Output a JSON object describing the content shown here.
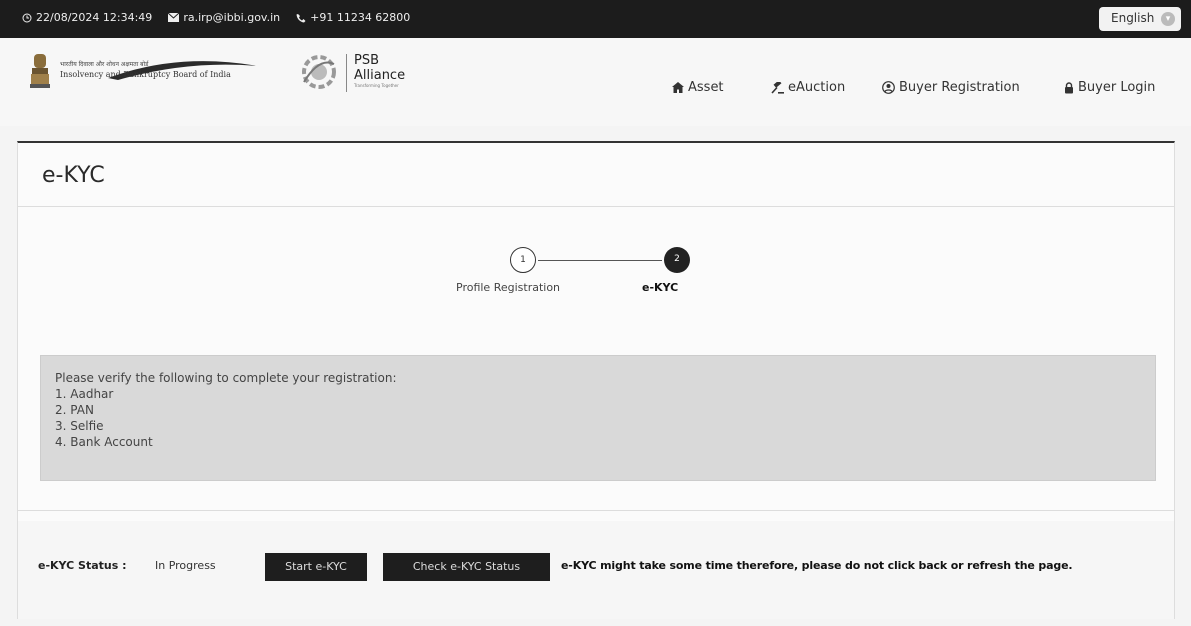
{
  "topbar": {
    "datetime": "22/08/2024 12:34:49",
    "email": "ra.irp@ibbi.gov.in",
    "phone": "+91 11234 62800",
    "language": "English"
  },
  "header": {
    "ibbi_hindi": "भारतीय दिवाला और शोधन अक्षमता बोर्ड",
    "ibbi_name": "Insolvency and Bankruptcy Board of India",
    "psb_line1": "PSB",
    "psb_line2": "Alliance",
    "psb_tagline": "Transforming Together"
  },
  "nav": {
    "asset": "Asset",
    "eauction": "eAuction",
    "buyer_registration": "Buyer Registration",
    "buyer_login": "Buyer Login"
  },
  "page": {
    "title": "e-KYC"
  },
  "stepper": {
    "steps": [
      {
        "number": "1",
        "label": "Profile Registration"
      },
      {
        "number": "2",
        "label": "e-KYC"
      }
    ]
  },
  "instructions": {
    "intro": "Please verify the following to complete your registration:",
    "items": [
      "1. Aadhar",
      "2. PAN",
      "3. Selfie",
      "4. Bank Account"
    ]
  },
  "status": {
    "label": "e-KYC Status :",
    "value": "In Progress",
    "start_button": "Start e-KYC",
    "check_button": "Check e-KYC Status",
    "warning": "e-KYC might take some time therefore, please do not click back or refresh the page."
  },
  "colors": {
    "topbar": "#1c1c1c",
    "button": "#1e1e1e",
    "info_box": "#d9d9d9"
  }
}
